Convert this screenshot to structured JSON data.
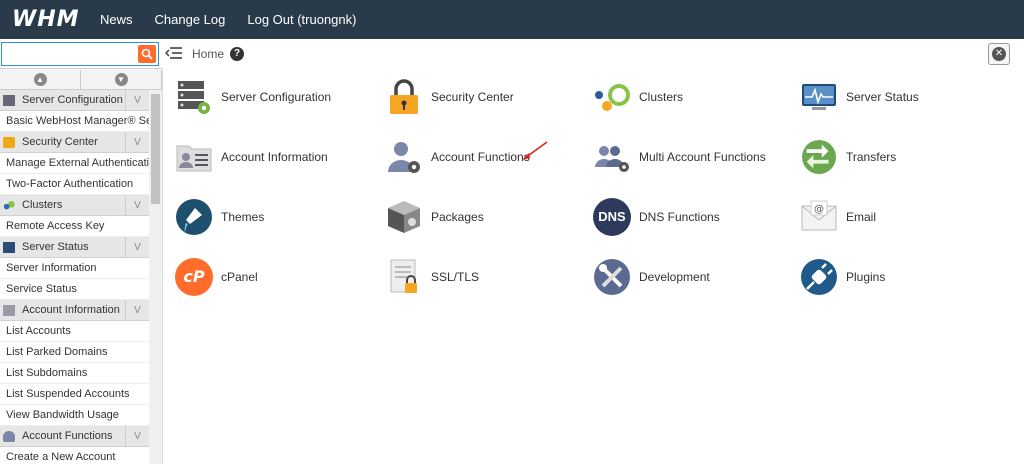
{
  "header": {
    "logo": "WHM",
    "nav": [
      "News",
      "Change Log",
      "Log Out (truongnk)"
    ]
  },
  "search": {
    "value": "",
    "placeholder": ""
  },
  "breadcrumb": {
    "home": "Home",
    "help": "?"
  },
  "sidebar": {
    "sections": [
      {
        "title": "Server Configuration",
        "items": [
          "Basic WebHost Manager® Setup"
        ]
      },
      {
        "title": "Security Center",
        "items": [
          "Manage External Authentications",
          "Two-Factor Authentication"
        ]
      },
      {
        "title": "Clusters",
        "items": [
          "Remote Access Key"
        ]
      },
      {
        "title": "Server Status",
        "items": [
          "Server Information",
          "Service Status"
        ]
      },
      {
        "title": "Account Information",
        "items": [
          "List Accounts",
          "List Parked Domains",
          "List Subdomains",
          "List Suspended Accounts",
          "View Bandwidth Usage"
        ]
      },
      {
        "title": "Account Functions",
        "items": [
          "Create a New Account"
        ]
      }
    ]
  },
  "tiles": [
    {
      "label": "Server Configuration",
      "icon": "server-config-icon"
    },
    {
      "label": "Security Center",
      "icon": "lock-icon"
    },
    {
      "label": "Clusters",
      "icon": "clusters-icon"
    },
    {
      "label": "Server Status",
      "icon": "monitor-icon"
    },
    {
      "label": "Account Information",
      "icon": "account-info-icon"
    },
    {
      "label": "Account Functions",
      "icon": "user-gear-icon"
    },
    {
      "label": "Multi Account Functions",
      "icon": "multi-user-icon"
    },
    {
      "label": "Transfers",
      "icon": "transfer-arrows-icon"
    },
    {
      "label": "Themes",
      "icon": "paint-icon"
    },
    {
      "label": "Packages",
      "icon": "box-icon"
    },
    {
      "label": "DNS Functions",
      "icon": "dns-icon",
      "text": "DNS"
    },
    {
      "label": "Email",
      "icon": "envelope-icon"
    },
    {
      "label": "cPanel",
      "icon": "cpanel-icon",
      "text": "cP"
    },
    {
      "label": "SSL/TLS",
      "icon": "certificate-icon"
    },
    {
      "label": "Development",
      "icon": "tools-icon"
    },
    {
      "label": "Plugins",
      "icon": "plug-icon"
    }
  ],
  "colors": {
    "topbar": "#293a4a",
    "search_button": "#ff6c2c",
    "annotation_arrow": "#e02020"
  }
}
